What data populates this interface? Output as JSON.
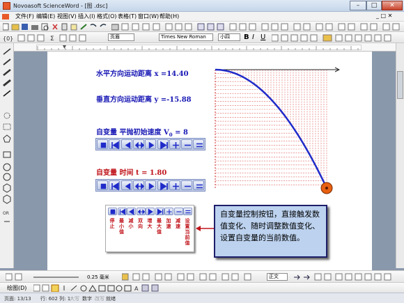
{
  "window": {
    "title": "Novoasoft ScienceWord - [图 .dsc]",
    "controls": [
      "minimize",
      "maximize",
      "close"
    ]
  },
  "menu": [
    "文件(F)",
    "编辑(E)",
    "视图(V)",
    "插入(I)",
    "格式(O)",
    "表格(T)",
    "窗口(W)",
    "帮助(H)"
  ],
  "toolbar2": {
    "style_select": "页眉",
    "font_select": "Times New Roman",
    "size_select": "小四",
    "bold": "B",
    "italic": "I",
    "underline": "U"
  },
  "toolbar3": {
    "sigma": "Σ",
    "format_label": "格式"
  },
  "doc": {
    "line1": "水平方向运动距离 x =14.40",
    "line2": "垂直方向运动距离 y =-15.88",
    "var1_label": "自变量 平抛初始速度 V",
    "var1_sub": "0",
    "var1_value": " = 8",
    "var2_label": "自变量 时间 t = 1.80",
    "control_glyphs": [
      "■",
      "|◀",
      "◀",
      "↔",
      "▶",
      "▶|",
      "+",
      "−",
      "="
    ],
    "legend_labels": [
      "停止",
      "最小值",
      "减小",
      "双向",
      "增大",
      "最大值",
      "加速",
      "减速",
      "设置当前值"
    ],
    "note": "自变量控制按钮，直接触发数值变化、随时调整数值变化、设置自变量的当前数值。"
  },
  "bottom": {
    "line_width": "0.25 毫米",
    "align": "正文"
  },
  "bottom2": {
    "draw_label": "绘图(D)"
  },
  "status": {
    "page": "页面: 13/13",
    "position": "行: 602 列: 1",
    "mode1": "大写",
    "mode2": "数字",
    "mode3": "改写",
    "mode4": "就绪"
  },
  "chart_data": {
    "type": "line",
    "title": "",
    "xlabel": "",
    "ylabel": "",
    "description": "trajectory of horizontally projected ball (parabola)",
    "x": [
      0,
      2,
      4,
      6,
      8,
      10,
      12,
      14.4
    ],
    "y": [
      0,
      -0.3,
      -1.2,
      -2.8,
      -4.9,
      -7.7,
      -11.1,
      -15.88
    ]
  }
}
